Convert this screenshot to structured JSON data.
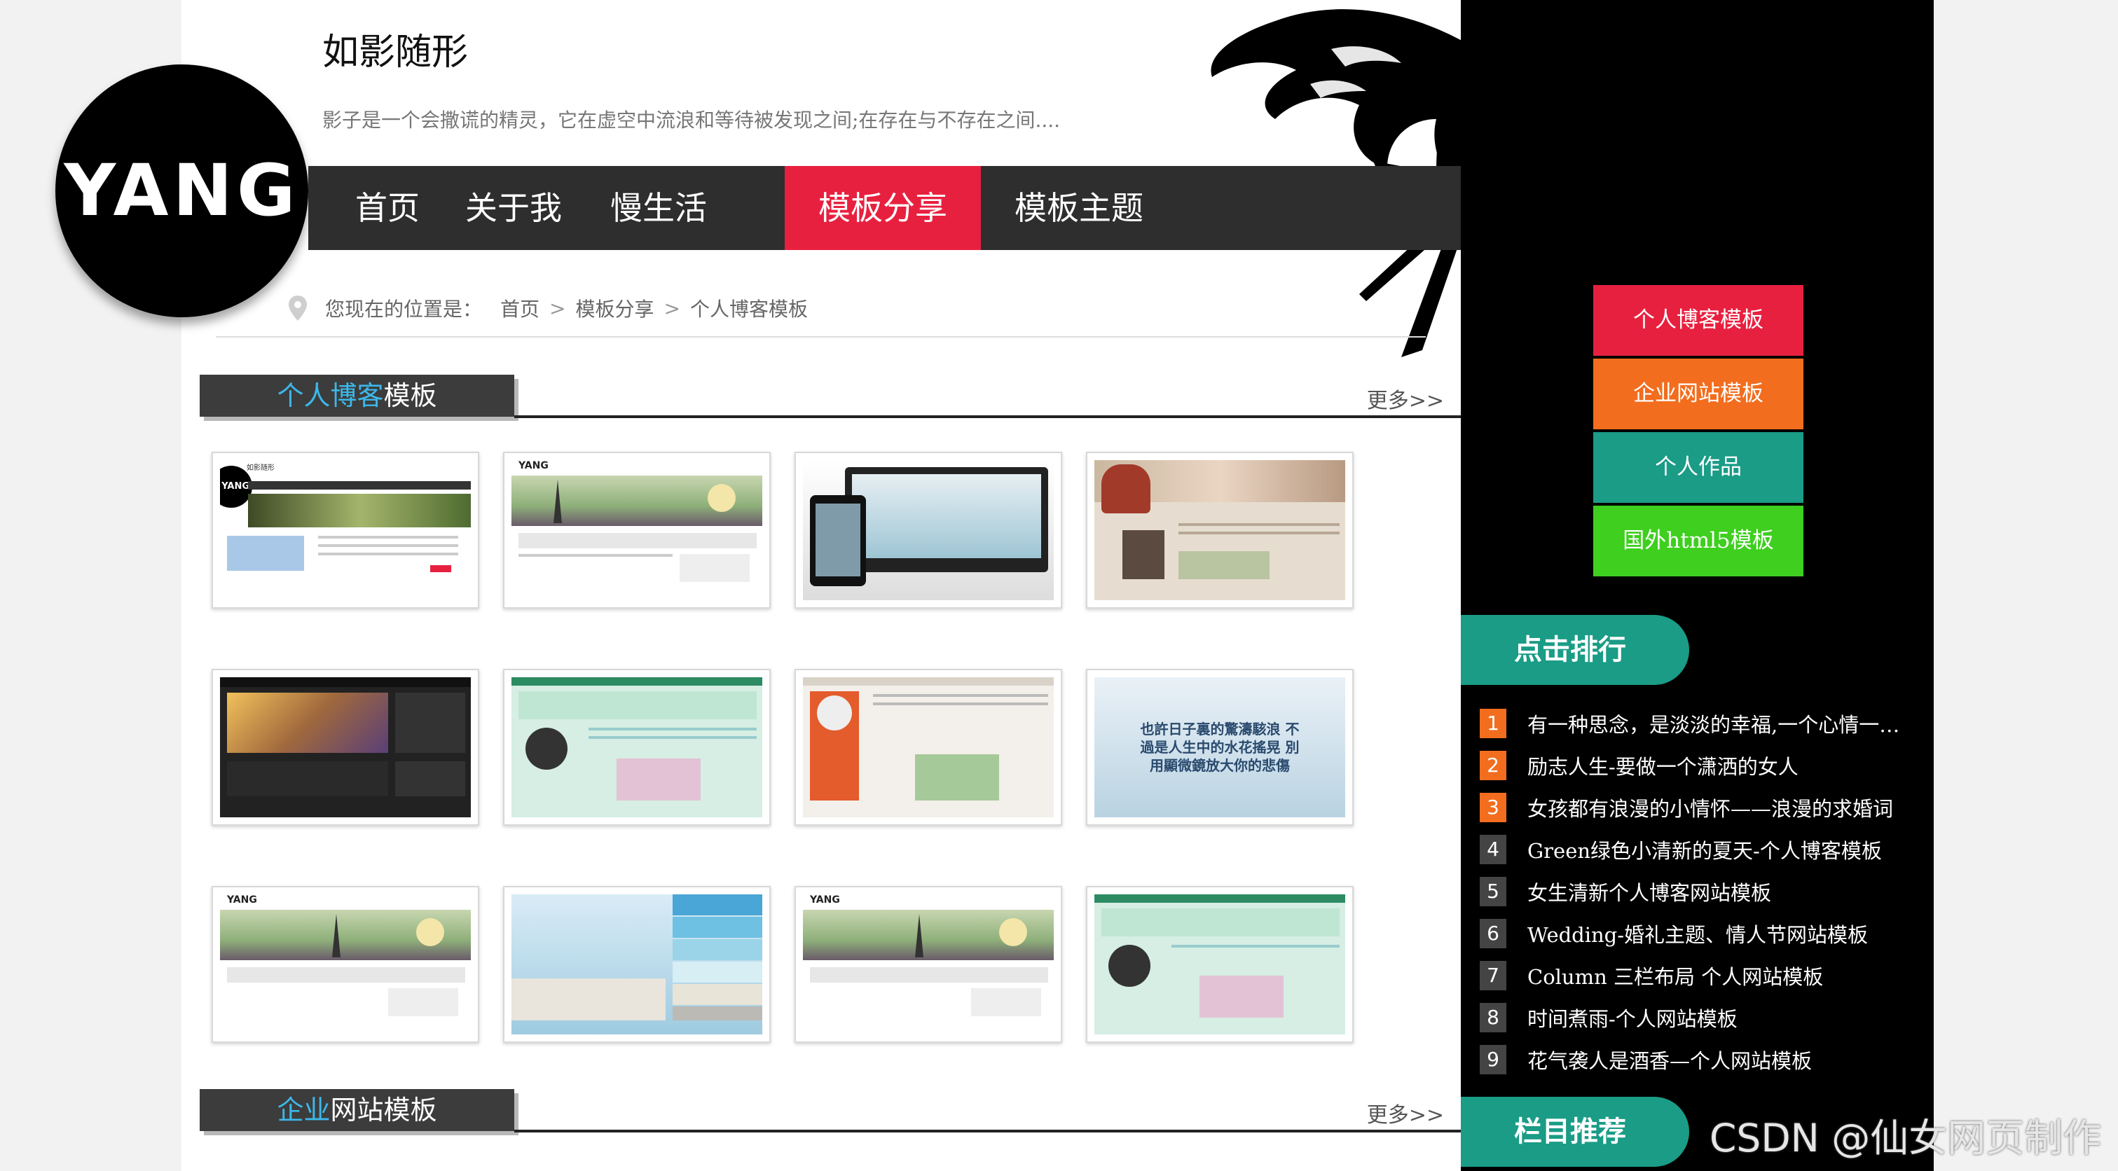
{
  "site": {
    "logo_text": "YANG",
    "title": "如影随形",
    "tagline": "影子是一个会撒谎的精灵，它在虚空中流浪和等待被发现之间;在存在与不存在之间...."
  },
  "nav": {
    "items": [
      {
        "label": "首页"
      },
      {
        "label": "关于我"
      },
      {
        "label": "慢生活"
      },
      {
        "label": "模板分享",
        "active": true
      },
      {
        "label": "模板主题"
      }
    ]
  },
  "breadcrumb": {
    "prefix": "您现在的位置是：",
    "items": [
      "首页",
      "模板分享",
      "个人博客模板"
    ],
    "sep": ">"
  },
  "sections": [
    {
      "title_highlight": "个人博客",
      "title_rest": "模板",
      "more": "更多>>"
    },
    {
      "title_highlight": "企业",
      "title_rest": "网站模板",
      "more": "更多>>"
    }
  ],
  "thumb_texts": {
    "poem": "也許日子裏的驚濤駭浪 不過是人生中的水花搖晃 別用顯微鏡放大你的悲傷",
    "mini_logo": "YANG",
    "mini_title": "如影随形"
  },
  "sidebar": {
    "buttons": [
      {
        "label": "个人博客模板",
        "color": "#e8203f"
      },
      {
        "label": "企业网站模板",
        "color": "#f26d1e"
      },
      {
        "label": "个人作品",
        "color": "#1a9c86"
      },
      {
        "label": "国外html5模板",
        "color": "#3ecf1f"
      }
    ],
    "rank_title": "点击排行",
    "rank_items": [
      {
        "num": "1",
        "text": "有一种思念，是淡淡的幸福,一个心情一…",
        "color": "#f26d1e"
      },
      {
        "num": "2",
        "text": "励志人生-要做一个潇洒的女人",
        "color": "#f26d1e"
      },
      {
        "num": "3",
        "text": "女孩都有浪漫的小情怀——浪漫的求婚词",
        "color": "#f26d1e"
      },
      {
        "num": "4",
        "text": "Green绿色小清新的夏天-个人博客模板",
        "color": "#444444"
      },
      {
        "num": "5",
        "text": "女生清新个人博客网站模板",
        "color": "#444444"
      },
      {
        "num": "6",
        "text": "Wedding-婚礼主题、情人节网站模板",
        "color": "#444444"
      },
      {
        "num": "7",
        "text": "Column 三栏布局 个人网站模板",
        "color": "#444444"
      },
      {
        "num": "8",
        "text": "时间煮雨-个人网站模板",
        "color": "#444444"
      },
      {
        "num": "9",
        "text": "花气袭人是酒香—个人网站模板",
        "color": "#444444"
      }
    ],
    "recommend_title": "栏目推荐"
  },
  "watermark": "CSDN @仙女网页制作"
}
